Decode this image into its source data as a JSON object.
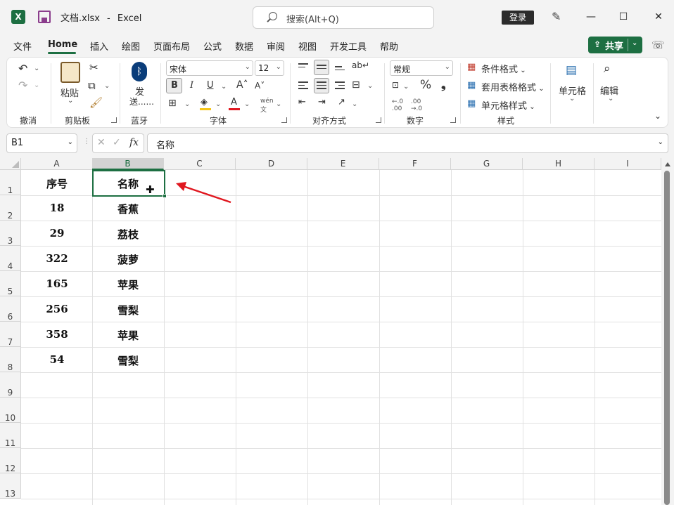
{
  "titlebar": {
    "filename": "文档.xlsx",
    "separator": "-",
    "app": "Excel",
    "search_placeholder": "搜索(Alt+Q)",
    "login": "登录"
  },
  "menu": {
    "items": [
      "文件",
      "Home",
      "插入",
      "绘图",
      "页面布局",
      "公式",
      "数据",
      "审阅",
      "视图",
      "开发工具",
      "帮助"
    ],
    "active": "Home",
    "share": "共享"
  },
  "ribbon": {
    "groups": {
      "undo": "撤消",
      "clipboard": "剪贴板",
      "bluetooth": "蓝牙",
      "font": "字体",
      "alignment": "对齐方式",
      "number": "数字",
      "styles": "样式"
    },
    "paste": "粘贴",
    "send": "发",
    "send2": "送......",
    "font_name": "宋体",
    "font_size": "12",
    "bold": "B",
    "italic": "I",
    "underline": "U",
    "number_format": "常规",
    "conditional_format": "条件格式",
    "table_format": "套用表格格式",
    "cell_style": "单元格样式",
    "cells": "单元格",
    "edit": "编辑"
  },
  "formula_bar": {
    "cell_ref": "B1",
    "fx": "fx",
    "content": "名称"
  },
  "sheet": {
    "columns": [
      "A",
      "B",
      "C",
      "D",
      "E",
      "F",
      "G",
      "H",
      "I"
    ],
    "rows": [
      "1",
      "2",
      "3",
      "4",
      "5",
      "6",
      "7",
      "8",
      "9",
      "10",
      "11",
      "12",
      "13"
    ],
    "data": [
      [
        "序号",
        "名称"
      ],
      [
        "18",
        "香蕉"
      ],
      [
        "29",
        "荔枝"
      ],
      [
        "322",
        "菠萝"
      ],
      [
        "165",
        "苹果"
      ],
      [
        "256",
        "雪梨"
      ],
      [
        "358",
        "苹果"
      ],
      [
        "54",
        "雪梨"
      ]
    ],
    "selected_cell": "B1"
  },
  "colors": {
    "accent": "#1d6f42",
    "arrow": "#e0171f"
  }
}
